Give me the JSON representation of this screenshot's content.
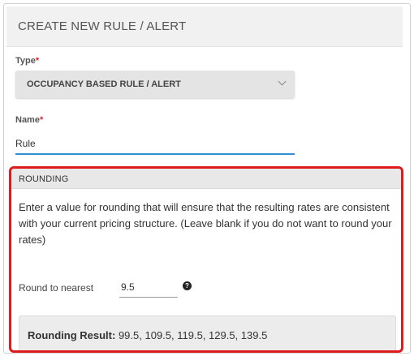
{
  "panel": {
    "title": "CREATE NEW RULE / ALERT"
  },
  "type_field": {
    "label": "Type",
    "required_mark": "*",
    "value": "OCCUPANCY BASED RULE / ALERT"
  },
  "name_field": {
    "label": "Name",
    "required_mark": "*",
    "value": "Rule"
  },
  "rounding": {
    "title": "ROUNDING",
    "description": "Enter a value for rounding that will ensure that the resulting rates are consistent with your current pricing structure. (Leave blank if you do not want to round your rates)",
    "round_label": "Round to nearest",
    "round_value": "9.5",
    "help_glyph": "?",
    "result_label": "Rounding Result:",
    "result_values": "99.5, 109.5, 119.5, 129.5, 139.5"
  },
  "colors": {
    "highlight_border": "#e01b1b",
    "input_focus": "#2f8fd6",
    "required": "#d9232e"
  },
  "icons": {
    "select_arrow": "chevron-down-icon",
    "help": "question-circle-icon"
  }
}
